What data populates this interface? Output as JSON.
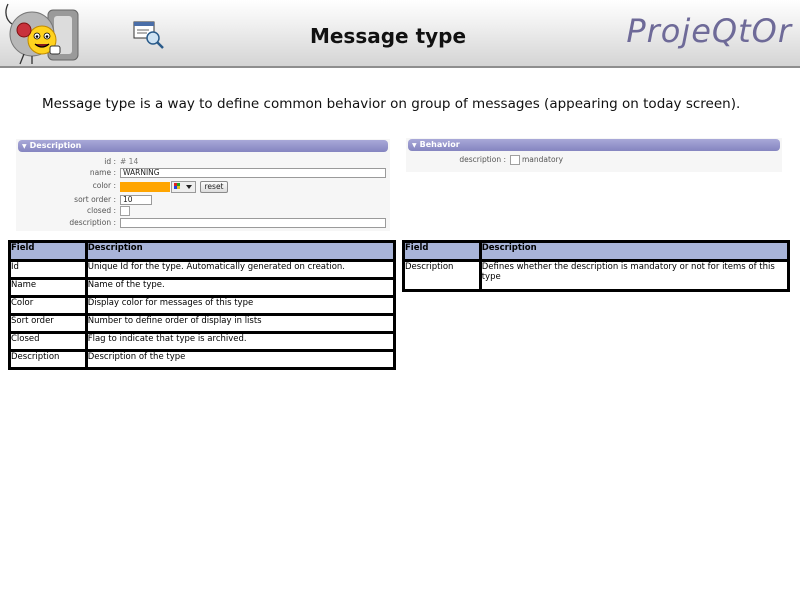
{
  "header": {
    "title": "Message type",
    "brand": "ProjeQtOr",
    "logo_icon": "smiley-mascot-icon",
    "screen_icon": "window-search-icon"
  },
  "intro": "Message type is a way to define common behavior on group of messages (appearing on today screen).",
  "colors": {
    "section_bar": "#8f8fc8",
    "table_header": "#a8b4d8",
    "brand": "#6e6a98",
    "swatch": "#ffa500"
  },
  "description_panel": {
    "title": "Description",
    "fields": {
      "id_label": "id :",
      "id_value": "# 14",
      "name_label": "name :",
      "name_value": "WARNING",
      "color_label": "color :",
      "reset_label": "reset",
      "sort_order_label": "sort order :",
      "sort_order_value": "10",
      "closed_label": "closed :",
      "description_label": "description :"
    }
  },
  "behavior_panel": {
    "title": "Behavior",
    "description_label": "description :",
    "mandatory_label": "mandatory"
  },
  "table_left": {
    "headers": [
      "Field",
      "Description"
    ],
    "rows": [
      [
        "Id",
        "Unique Id for the type. Automatically generated on creation."
      ],
      [
        "Name",
        "Name of the type."
      ],
      [
        "Color",
        "Display color for messages of this type"
      ],
      [
        "Sort order",
        "Number to define order of display in lists"
      ],
      [
        "Closed",
        "Flag to indicate that type is archived."
      ],
      [
        "Description",
        "Description of the type"
      ]
    ]
  },
  "table_right": {
    "headers": [
      "Field",
      "Description"
    ],
    "rows": [
      [
        "Description",
        "Defines whether the description is mandatory or not for items of this type"
      ]
    ]
  }
}
